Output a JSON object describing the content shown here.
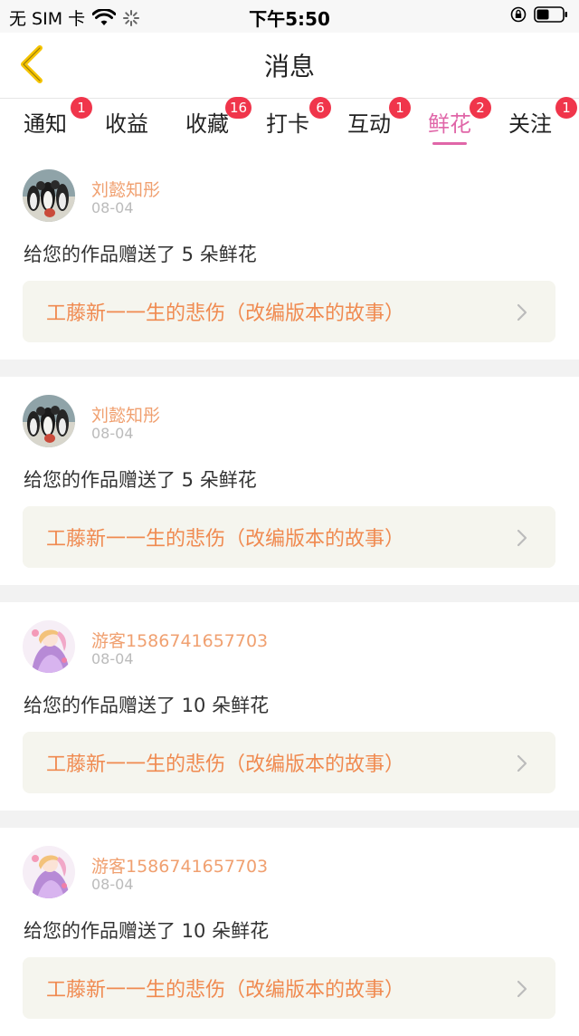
{
  "status_bar": {
    "carrier": "无 SIM 卡",
    "time": "下午5:50",
    "icons": [
      "wifi-icon",
      "activity-spinner-icon",
      "orientation-lock-icon",
      "battery-icon"
    ]
  },
  "nav": {
    "title": "消息",
    "back_icon": "chevron-left-icon"
  },
  "colors": {
    "accent": "#e066a8",
    "badge": "#f0354b",
    "username": "#f0a070",
    "work_title": "#f08a50",
    "back": "#f5c400"
  },
  "tabs": [
    {
      "label": "通知",
      "badge": "1",
      "active": false
    },
    {
      "label": "收益",
      "badge": "",
      "active": false
    },
    {
      "label": "收藏",
      "badge": "16",
      "active": false
    },
    {
      "label": "打卡",
      "badge": "6",
      "active": false
    },
    {
      "label": "互动",
      "badge": "1",
      "active": false
    },
    {
      "label": "鲜花",
      "badge": "2",
      "active": true
    },
    {
      "label": "关注",
      "badge": "1",
      "active": false
    }
  ],
  "items": [
    {
      "user": "刘懿知彤",
      "date": "08-04",
      "avatar": "penguin-avatar",
      "message": "给您的作品赠送了 5 朵鲜花",
      "work": "工藤新一一生的悲伤（改编版本的故事）"
    },
    {
      "user": "刘懿知彤",
      "date": "08-04",
      "avatar": "penguin-avatar",
      "message": "给您的作品赠送了 5 朵鲜花",
      "work": "工藤新一一生的悲伤（改编版本的故事）"
    },
    {
      "user": "游客1586741657703",
      "date": "08-04",
      "avatar": "anime-girl-avatar",
      "message": "给您的作品赠送了 10 朵鲜花",
      "work": "工藤新一一生的悲伤（改编版本的故事）"
    },
    {
      "user": "游客1586741657703",
      "date": "08-04",
      "avatar": "anime-girl-avatar",
      "message": "给您的作品赠送了 10 朵鲜花",
      "work": "工藤新一一生的悲伤（改编版本的故事）"
    }
  ]
}
